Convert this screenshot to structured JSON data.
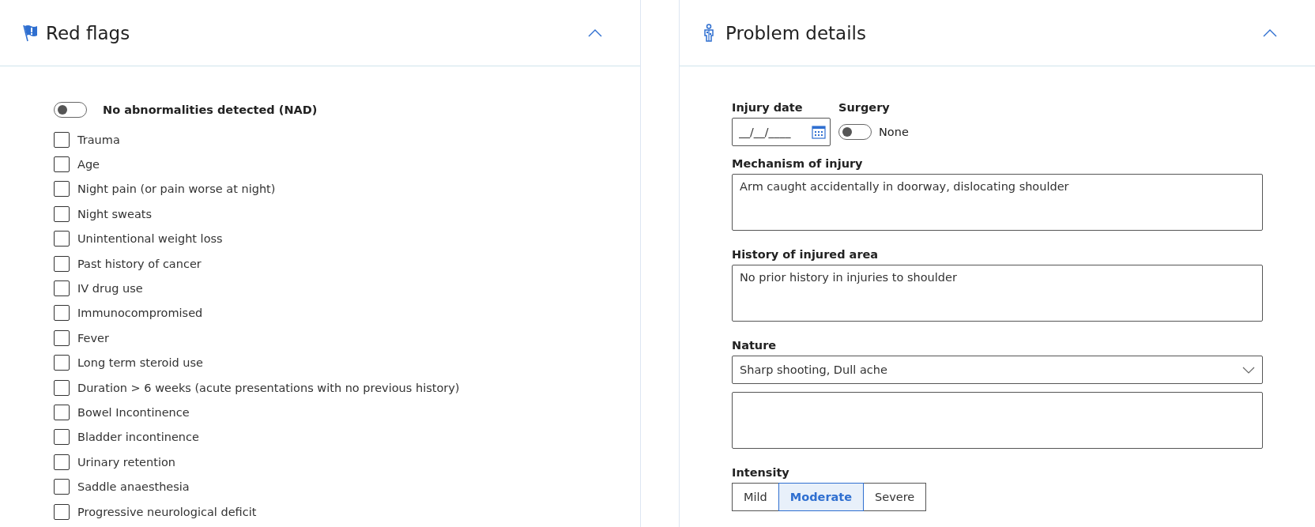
{
  "red_flags": {
    "title": "Red flags",
    "expanded": true,
    "nad_toggle": {
      "label": "No abnormalities detected (NAD)",
      "on": false
    },
    "items": [
      {
        "label": "Trauma",
        "checked": false
      },
      {
        "label": "Age",
        "checked": false
      },
      {
        "label": "Night pain (or pain worse at night)",
        "checked": false
      },
      {
        "label": "Night sweats",
        "checked": false
      },
      {
        "label": "Unintentional weight loss",
        "checked": false
      },
      {
        "label": "Past history of cancer",
        "checked": false
      },
      {
        "label": "IV drug use",
        "checked": false
      },
      {
        "label": "Immunocompromised",
        "checked": false
      },
      {
        "label": "Fever",
        "checked": false
      },
      {
        "label": "Long term steroid use",
        "checked": false
      },
      {
        "label": "Duration > 6 weeks (acute presentations with no previous history)",
        "checked": false
      },
      {
        "label": "Bowel Incontinence",
        "checked": false
      },
      {
        "label": "Bladder incontinence",
        "checked": false
      },
      {
        "label": "Urinary retention",
        "checked": false
      },
      {
        "label": "Saddle anaesthesia",
        "checked": false
      },
      {
        "label": "Progressive neurological deficit",
        "checked": false
      }
    ]
  },
  "problem_details": {
    "title": "Problem details",
    "expanded": true,
    "injury_date": {
      "label": "Injury date",
      "placeholder": "__/__/____"
    },
    "surgery": {
      "label": "Surgery",
      "on": false,
      "state_text": "None"
    },
    "mechanism": {
      "label": "Mechanism of injury",
      "value": "Arm caught accidentally in doorway, dislocating shoulder"
    },
    "history": {
      "label": "History of injured area",
      "value": "No prior history in injuries to shoulder"
    },
    "nature": {
      "label": "Nature",
      "value": "Sharp shooting, Dull ache"
    },
    "intensity": {
      "label": "Intensity",
      "options": [
        {
          "label": "Mild",
          "selected": false
        },
        {
          "label": "Moderate",
          "selected": true
        },
        {
          "label": "Severe",
          "selected": false
        }
      ]
    }
  }
}
